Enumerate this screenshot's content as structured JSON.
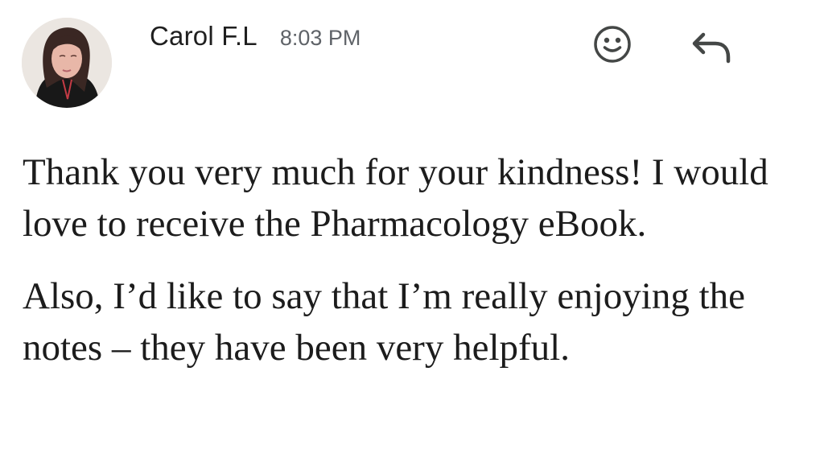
{
  "message": {
    "sender_name": "Carol F.L",
    "time": "8:03 PM",
    "paragraphs": [
      "Thank you very much for your kindness! I would love to receive the Pharmacology eBook.",
      "Also, I’d like to say that I’m really enjoying the notes – they have been very helpful."
    ]
  },
  "actions": {
    "emoji_icon": "smiley-face-icon",
    "reply_icon": "reply-arrow-icon"
  },
  "colors": {
    "sender_text": "#1f1f1f",
    "time_text": "#5f6368",
    "body_text": "#1c1c1c",
    "icon_stroke": "#444746"
  }
}
